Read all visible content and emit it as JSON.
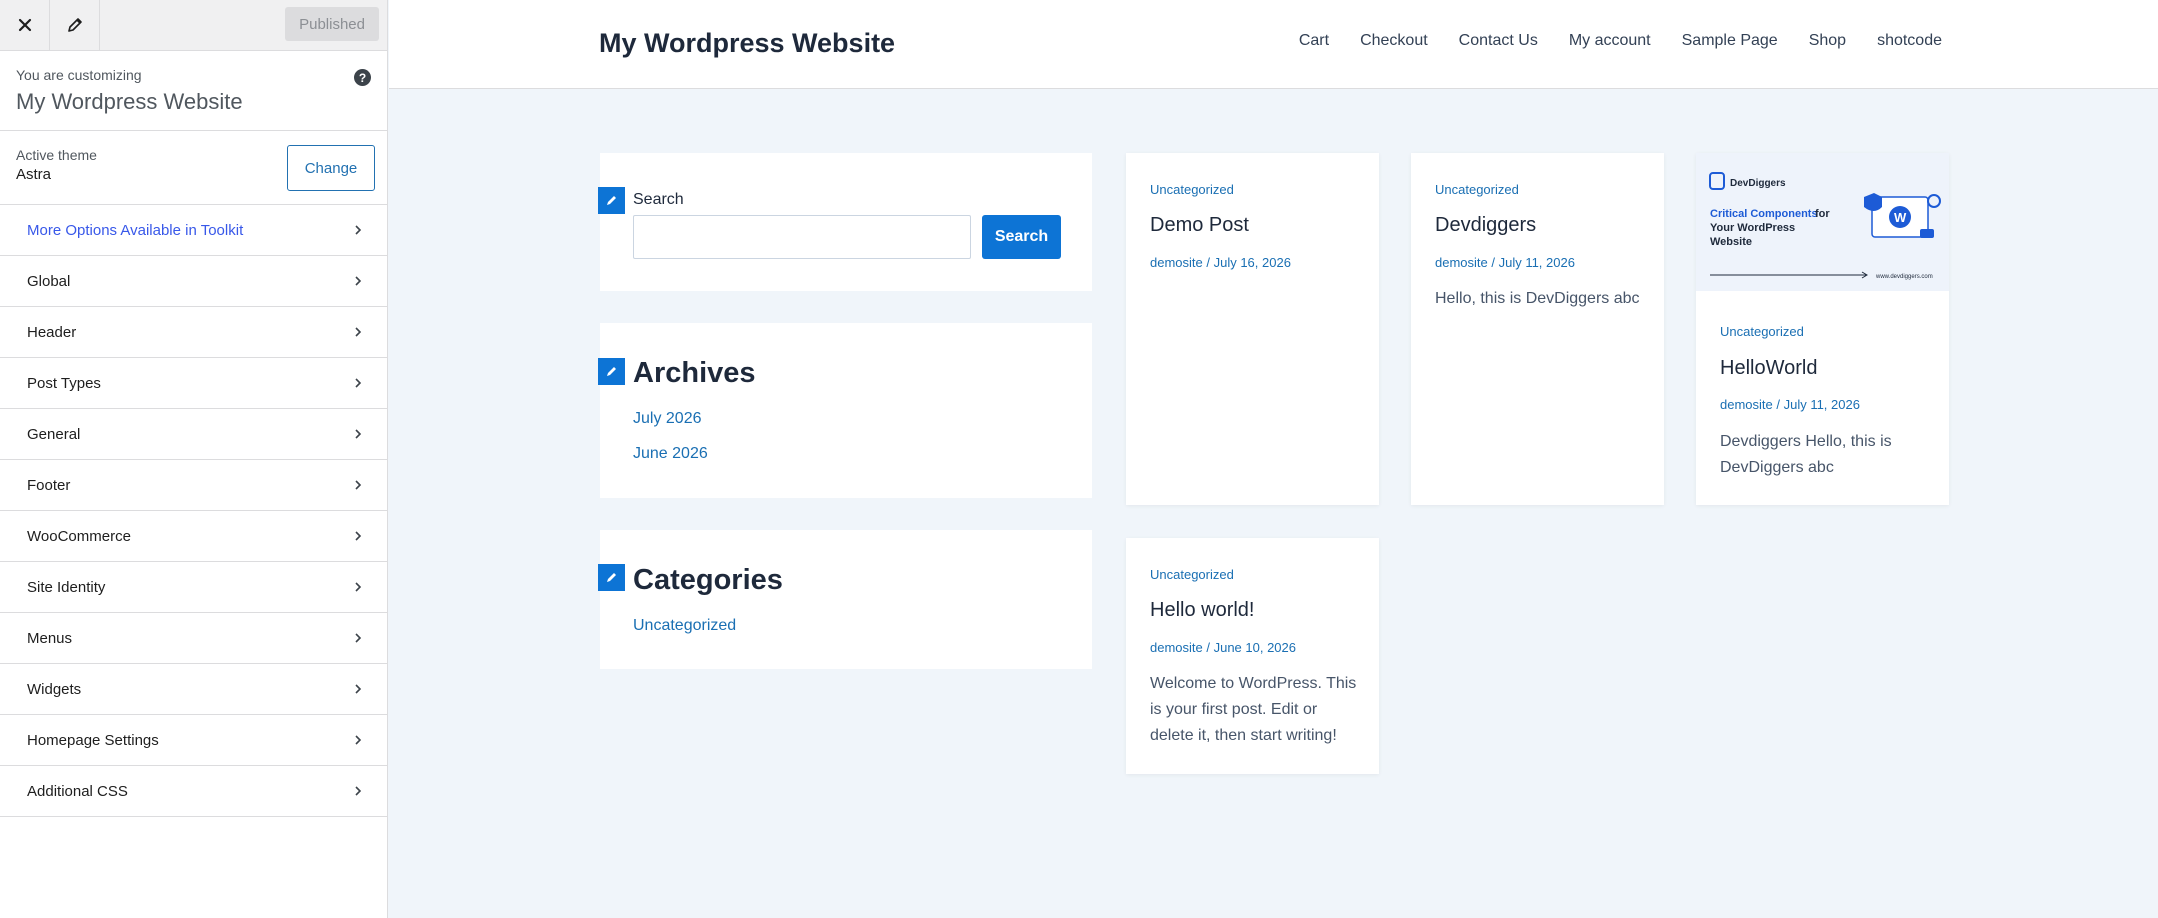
{
  "topbar": {
    "published_label": "Published"
  },
  "customizer": {
    "info_sub": "You are customizing",
    "site_name": "My Wordpress Website",
    "help_icon": "?",
    "active_theme_label": "Active theme",
    "theme_name": "Astra",
    "change_label": "Change"
  },
  "panels": [
    "More Options Available in Toolkit",
    "Global",
    "Header",
    "Post Types",
    "General",
    "Footer",
    "WooCommerce",
    "Site Identity",
    "Menus",
    "Widgets",
    "Homepage Settings",
    "Additional CSS"
  ],
  "site": {
    "title": "My Wordpress Website",
    "nav": [
      "Cart",
      "Checkout",
      "Contact Us",
      "My account",
      "Sample Page",
      "Shop",
      "shotcode"
    ]
  },
  "widgets": {
    "search": {
      "label": "Search",
      "button": "Search"
    },
    "archives": {
      "heading": "Archives",
      "items": [
        "July 2026",
        "June 2026"
      ]
    },
    "categories": {
      "heading": "Categories",
      "items": [
        "Uncategorized"
      ]
    }
  },
  "posts": [
    {
      "category": "Uncategorized",
      "title": "Demo Post",
      "meta": "demosite / July 16, 2026",
      "excerpt": ""
    },
    {
      "category": "Uncategorized",
      "title": "Devdiggers",
      "meta": "demosite / July 11, 2026",
      "excerpt": "Hello, this is DevDiggers abc"
    },
    {
      "category": "Uncategorized",
      "title": "HelloWorld",
      "meta": "demosite / July 11, 2026",
      "excerpt": "Devdiggers Hello, this is DevDiggers abc"
    },
    {
      "category": "Uncategorized",
      "title": "Hello world!",
      "meta": "demosite / June 10, 2026",
      "excerpt": "Welcome to WordPress. This is your first post. Edit or delete it, then start writing!"
    }
  ],
  "thumbnail": {
    "brand": "DevDiggers",
    "headline_accent": "Critical Components",
    "headline_rest_1": " for",
    "headline_line2": "Your WordPress",
    "headline_line3": "Website",
    "url": "www.devdiggers.com"
  },
  "colors": {
    "accent": "#0d74d5",
    "link": "#1a6fb3",
    "toolkit": "#3858e9"
  }
}
